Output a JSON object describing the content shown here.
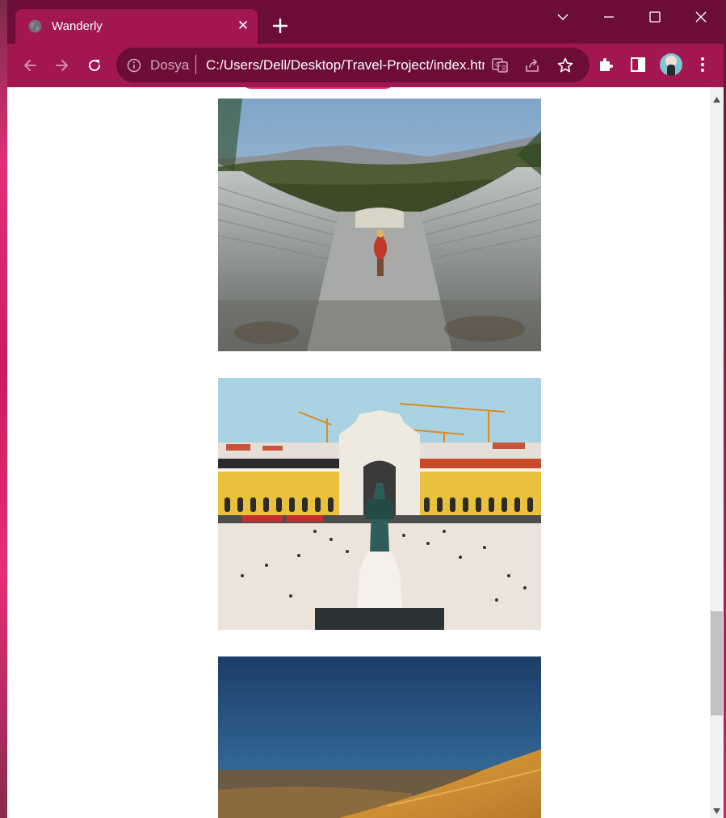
{
  "browser": {
    "tab": {
      "title": "Wanderly",
      "close_glyph": "✕"
    },
    "new_tab_icon": "plus-icon",
    "omnibox": {
      "site_info_label": "Dosya",
      "url": "C:/Users/Dell/Desktop/Travel-Project/index.html"
    },
    "window_controls": [
      "tab-search",
      "minimize",
      "maximize",
      "close"
    ],
    "toolbar_icons": [
      "back-arrow-icon",
      "forward-arrow-icon",
      "reload-icon",
      "translate-icon",
      "share-icon",
      "bookmark-star-icon",
      "extensions-puzzle-icon",
      "side-panel-icon",
      "profile-avatar",
      "more-menu-icon"
    ]
  },
  "page": {
    "photos": [
      {
        "subject": "ancient-amphitheater"
      },
      {
        "subject": "city-square-with-statue"
      },
      {
        "subject": "desert-dunes"
      }
    ]
  },
  "scrollbar": {
    "position_fraction": 0.72
  },
  "colors": {
    "titlebar": "#6b0d38",
    "toolbar": "#a21652",
    "omnibox": "#6b0d38",
    "accent": "#e8266e"
  }
}
